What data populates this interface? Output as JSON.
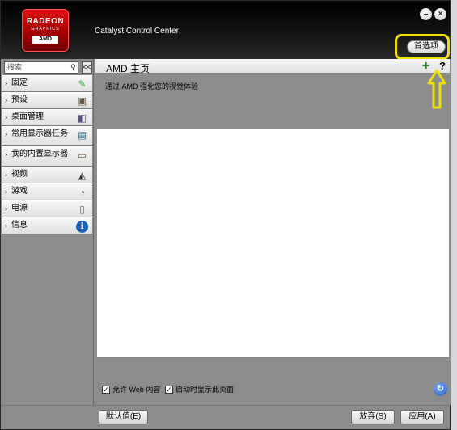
{
  "app": {
    "logo_line1": "RADEON",
    "logo_line2": "GRAPHICS",
    "logo_badge": "AMD",
    "title": "Catalyst Control Center",
    "minimize_glyph": "–",
    "close_glyph": "×",
    "preferences_label": "首选项"
  },
  "sidebar": {
    "search_placeholder": "搜索",
    "search_icon": "magnifier-icon",
    "collapse_glyph": "<<",
    "items": [
      {
        "label": "固定",
        "icon": "pin-icon",
        "glyph": "✎"
      },
      {
        "label": "预设",
        "icon": "preset-icon",
        "glyph": "▣"
      },
      {
        "label": "桌面管理",
        "icon": "desktop-manager-icon",
        "glyph": "◧"
      },
      {
        "label": "常用显示器任务",
        "icon": "display-tasks-icon",
        "glyph": "▤"
      },
      {
        "label": "我的内置显示器",
        "icon": "laptop-display-icon",
        "glyph": "▭"
      },
      {
        "label": "视频",
        "icon": "video-icon",
        "glyph": "◭"
      },
      {
        "label": "游戏",
        "icon": "gamepad-icon",
        "glyph": "◔"
      },
      {
        "label": "电源",
        "icon": "power-icon",
        "glyph": "▯"
      },
      {
        "label": "信息",
        "icon": "info-icon",
        "glyph": "i"
      }
    ]
  },
  "content": {
    "page_title": "AMD 主页",
    "subtitle": "通过 AMD 强化您的视觉体验",
    "help_glyph": "?",
    "pin_glyph": "✚",
    "checkbox_web": {
      "label": "允许 Web 内容",
      "checked": true
    },
    "checkbox_startup": {
      "label": "启动时显示此页面",
      "checked": true
    },
    "check_glyph": "✓",
    "refresh_glyph": "↻"
  },
  "footer": {
    "default_label": "默认值(E)",
    "discard_label": "放弃(S)",
    "apply_label": "应用(A)"
  },
  "colors": {
    "highlight": "#f0e000",
    "window_bg": "#8c8c8c",
    "header_bg": "#000000"
  }
}
